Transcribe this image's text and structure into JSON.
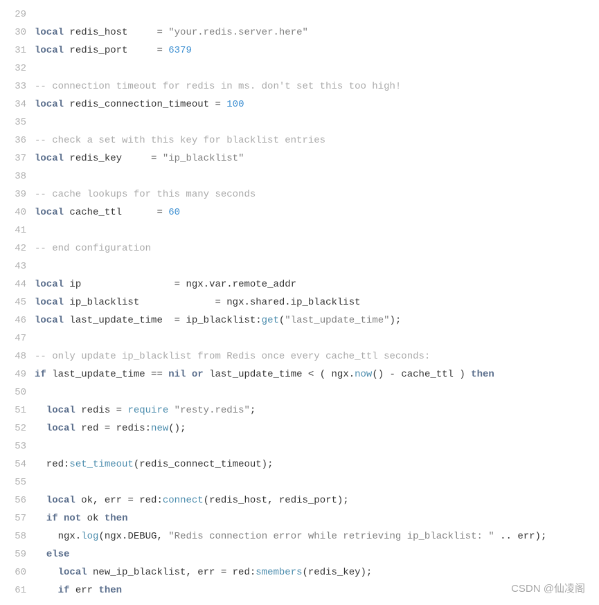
{
  "watermark": "CSDN @仙凌阁",
  "lines": [
    {
      "n": 29,
      "html": ""
    },
    {
      "n": 30,
      "html": "<span class='kw'>local</span> <span class='id'>redis_host</span>     = <span class='str'>\"your.redis.server.here\"</span>"
    },
    {
      "n": 31,
      "html": "<span class='kw'>local</span> <span class='id'>redis_port</span>     = <span class='num'>6379</span>"
    },
    {
      "n": 32,
      "html": ""
    },
    {
      "n": 33,
      "html": "<span class='cm'>-- connection timeout for redis in ms. don't set this too high!</span>"
    },
    {
      "n": 34,
      "html": "<span class='kw'>local</span> <span class='id'>redis_connection_timeout</span> = <span class='num'>100</span>"
    },
    {
      "n": 35,
      "html": ""
    },
    {
      "n": 36,
      "html": "<span class='cm'>-- check a set with this key for blacklist entries</span>"
    },
    {
      "n": 37,
      "html": "<span class='kw'>local</span> <span class='id'>redis_key</span>     = <span class='str'>\"ip_blacklist\"</span>"
    },
    {
      "n": 38,
      "html": ""
    },
    {
      "n": 39,
      "html": "<span class='cm'>-- cache lookups for this many seconds</span>"
    },
    {
      "n": 40,
      "html": "<span class='kw'>local</span> <span class='id'>cache_ttl</span>      = <span class='num'>60</span>"
    },
    {
      "n": 41,
      "html": ""
    },
    {
      "n": 42,
      "html": "<span class='cm'>-- end configuration</span>"
    },
    {
      "n": 43,
      "html": ""
    },
    {
      "n": 44,
      "html": "<span class='kw'>local</span> <span class='id'>ip</span>                = ngx.var.remote_addr"
    },
    {
      "n": 45,
      "html": "<span class='kw'>local</span> <span class='id'>ip_blacklist</span>             = ngx.shared.ip_blacklist"
    },
    {
      "n": 46,
      "html": "<span class='kw'>local</span> <span class='id'>last_update_time</span>  = ip_blacklist:<span class='fn'>get</span>(<span class='str'>\"last_update_time\"</span>);"
    },
    {
      "n": 47,
      "html": ""
    },
    {
      "n": 48,
      "html": "<span class='cm'>-- only update ip_blacklist from Redis once every cache_ttl seconds:</span>"
    },
    {
      "n": 49,
      "html": "<span class='kw'>if</span> last_update_time == <span class='kw'>nil</span> <span class='kw'>or</span> last_update_time &lt; ( ngx.<span class='fn'>now</span>() - cache_ttl ) <span class='kw'>then</span>"
    },
    {
      "n": 50,
      "html": ""
    },
    {
      "n": 51,
      "html": "  <span class='kw'>local</span> redis = <span class='fn'>require</span> <span class='str'>\"resty.redis\"</span>;"
    },
    {
      "n": 52,
      "html": "  <span class='kw'>local</span> red = redis:<span class='fn'>new</span>();"
    },
    {
      "n": 53,
      "html": ""
    },
    {
      "n": 54,
      "html": "  red:<span class='fn'>set_timeout</span>(redis_connect_timeout);"
    },
    {
      "n": 55,
      "html": ""
    },
    {
      "n": 56,
      "html": "  <span class='kw'>local</span> ok, err = red:<span class='fn'>connect</span>(redis_host, redis_port);"
    },
    {
      "n": 57,
      "html": "  <span class='kw'>if</span> <span class='kw'>not</span> ok <span class='kw'>then</span>"
    },
    {
      "n": 58,
      "html": "    ngx.<span class='fn'>log</span>(ngx.DEBUG, <span class='str'>\"Redis connection error while retrieving ip_blacklist: \"</span> .. err);"
    },
    {
      "n": 59,
      "html": "  <span class='kw'>else</span>"
    },
    {
      "n": 60,
      "html": "    <span class='kw'>local</span> new_ip_blacklist, err = red:<span class='fn'>smembers</span>(redis_key);"
    },
    {
      "n": 61,
      "html": "    <span class='kw'>if</span> err <span class='kw'>then</span>"
    }
  ]
}
